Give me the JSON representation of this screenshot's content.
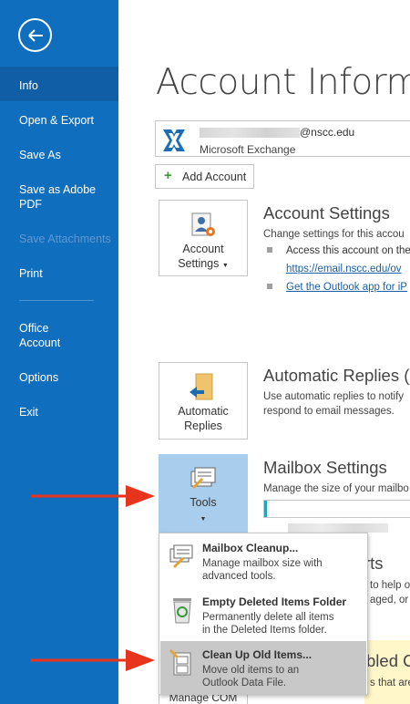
{
  "sidebar": {
    "items": [
      {
        "label": "Info"
      },
      {
        "label": "Open & Export"
      },
      {
        "label": "Save As"
      },
      {
        "label": "Save as Adobe PDF"
      },
      {
        "label": "Save Attachments"
      },
      {
        "label": "Print"
      },
      {
        "label": "Office Account"
      },
      {
        "label": "Options"
      },
      {
        "label": "Exit"
      }
    ]
  },
  "main": {
    "title": "Account Informat",
    "account": {
      "email_domain": "@nscc.edu",
      "type": "Microsoft Exchange"
    },
    "add_account_label": "Add Account",
    "account_settings": {
      "button_label_1": "Account",
      "button_label_2": "Settings",
      "title": "Account Settings",
      "text": "Change settings for this accou",
      "bullet1_text": "Access this account on the",
      "bullet1_link": "https://email.nscc.edu/ov",
      "bullet2_link": "Get the Outlook app for iP"
    },
    "automatic_replies": {
      "button_label_1": "Automatic",
      "button_label_2": "Replies",
      "title": "Automatic Replies (C",
      "text_line1": "Use automatic replies to notify",
      "text_line2": "respond to email messages."
    },
    "mailbox_settings": {
      "button_label": "Tools",
      "title": "Mailbox Settings",
      "text": "Manage the size of your mailbo",
      "progress_fraction": 0.02
    },
    "partial_texts": {
      "rts": "rts",
      "help": "to help or",
      "managed": "aged, or r",
      "bled": "bled C",
      "that_are": "s that are"
    },
    "manage_com_label": "Manage COM"
  },
  "menu": {
    "items": [
      {
        "title": "Mailbox Cleanup...",
        "desc_line1": "Manage mailbox size with",
        "desc_line2": "advanced tools."
      },
      {
        "title": "Empty Deleted Items Folder",
        "desc_line1": "Permanently delete all items",
        "desc_line2": "in the Deleted Items folder."
      },
      {
        "title": "Clean Up Old Items...",
        "desc_line1": "Move old items to an",
        "desc_line2": "Outlook Data File."
      }
    ]
  },
  "colors": {
    "sidebar": "#106ebe",
    "sidebar_active": "#0f5ea6",
    "tools_pressed": "#a9cdec",
    "menu_hover": "#c8c8c8",
    "arrow": "#e8341c",
    "progress": "#26a3bd"
  }
}
